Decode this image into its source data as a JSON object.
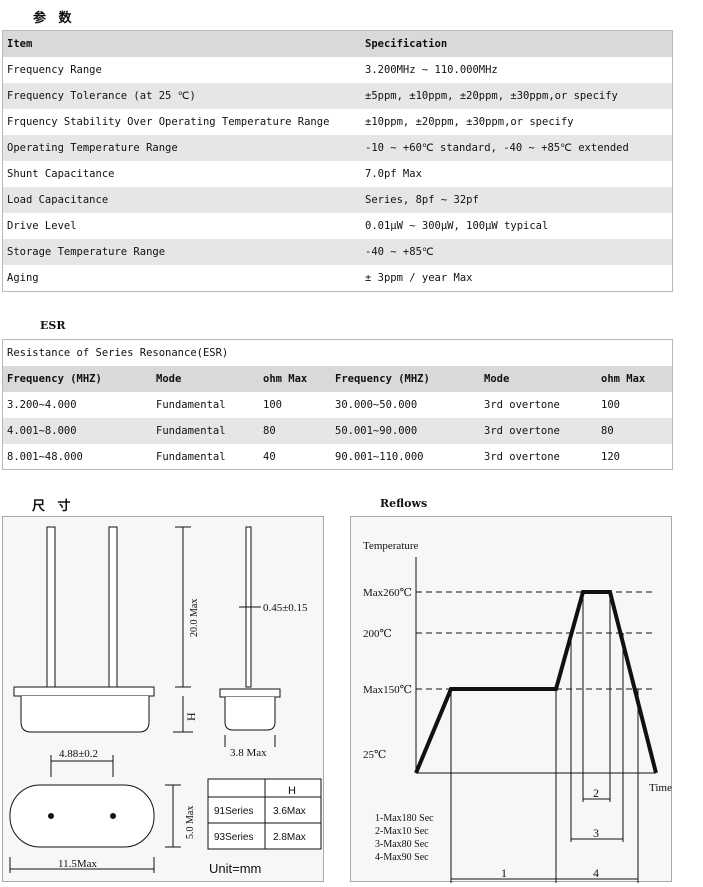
{
  "params": {
    "heading": "参 数",
    "header": {
      "item": "Item",
      "spec": "Specification"
    },
    "rows": [
      {
        "item": "Frequency Range",
        "spec": "3.200MHz ~ 110.000MHz"
      },
      {
        "item": "Frequency Tolerance (at 25 ℃)",
        "spec": "±5ppm, ±10ppm, ±20ppm, ±30ppm,or specify"
      },
      {
        "item": "Frquency Stability Over Operating Temperature Range",
        "spec": "±10ppm, ±20ppm, ±30ppm,or specify"
      },
      {
        "item": "Operating Temperature Range",
        "spec": "-10 ~ +60℃ standard, -40 ~ +85℃ extended"
      },
      {
        "item": "Shunt Capacitance",
        "spec": "7.0pf Max"
      },
      {
        "item": "Load Capacitance",
        "spec": "Series, 8pf ~ 32pf"
      },
      {
        "item": "Drive Level",
        "spec": "0.01μW ~ 300μW, 100μW typical"
      },
      {
        "item": "Storage Temperature Range",
        "spec": "-40 ~ +85℃"
      },
      {
        "item": "Aging",
        "spec": "± 3ppm / year Max"
      }
    ]
  },
  "esr": {
    "heading": "ESR",
    "title": "Resistance of Series Resonance(ESR)",
    "headers": [
      "Frequency (MHZ)",
      "Mode",
      "ohm Max",
      "Frequency (MHZ)",
      "Mode",
      "ohm Max"
    ],
    "rows": [
      [
        "3.200~4.000",
        "Fundamental",
        "100",
        "30.000~50.000",
        "3rd overtone",
        "100"
      ],
      [
        "4.001~8.000",
        "Fundamental",
        "80",
        "50.001~90.000",
        "3rd overtone",
        "80"
      ],
      [
        "8.001~48.000",
        "Fundamental",
        "40",
        "90.001~110.000",
        "3rd overtone",
        "120"
      ]
    ]
  },
  "dimensions": {
    "heading": "尺 寸",
    "labels": {
      "lead_length": "20.0 Max",
      "lead_dia": "0.45±0.15",
      "height": "H",
      "thickness": "3.8 Max",
      "pitch": "4.88±0.2",
      "width": "5.0 Max",
      "length": "11.5Max",
      "unit": "Unit=mm"
    },
    "series_table": {
      "header": "H",
      "rows": [
        {
          "series": "91Series",
          "h": "3.6Max"
        },
        {
          "series": "93Series",
          "h": "2.8Max"
        }
      ]
    }
  },
  "reflows": {
    "heading": "Reflows",
    "y_axis_label": "Temperature",
    "x_axis_label": "Time",
    "levels": [
      "Max260℃",
      "200℃",
      "Max150℃",
      "25℃"
    ],
    "segments": [
      "1",
      "2",
      "3",
      "4"
    ],
    "legend": [
      "1-Max180 Sec",
      "2-Max10 Sec",
      "3-Max80 Sec",
      "4-Max90 Sec"
    ]
  }
}
